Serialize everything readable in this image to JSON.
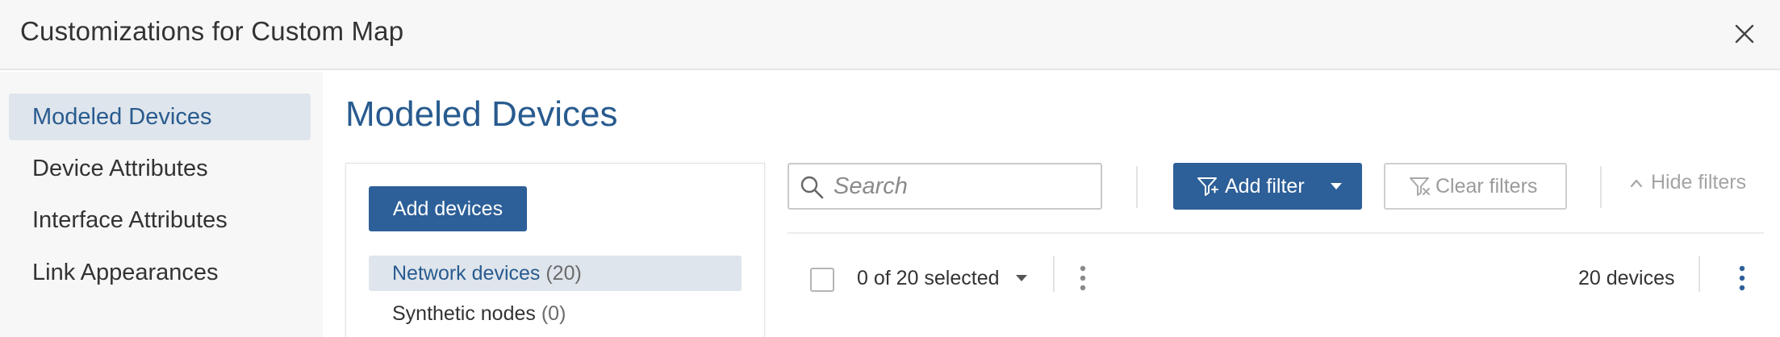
{
  "header": {
    "title": "Customizations for Custom Map"
  },
  "sidebar": {
    "items": [
      {
        "label": "Modeled Devices",
        "active": true
      },
      {
        "label": "Device Attributes",
        "active": false
      },
      {
        "label": "Interface Attributes",
        "active": false
      },
      {
        "label": "Link Appearances",
        "active": false
      }
    ]
  },
  "main": {
    "title": "Modeled Devices",
    "add_devices_label": "Add devices",
    "node_types": [
      {
        "label": "Network devices",
        "count": "(20)",
        "active": true
      },
      {
        "label": "Synthetic nodes",
        "count": "(0)",
        "active": false
      }
    ],
    "search": {
      "placeholder": "Search",
      "value": ""
    },
    "add_filter_label": "Add filter",
    "clear_filters_label": "Clear filters",
    "hide_filters_label": "Hide filters",
    "selection_text": "0 of 20 selected",
    "device_count": "20 devices"
  },
  "icons": {
    "close": "close-icon",
    "search": "search-icon",
    "filter": "filter-icon",
    "filter_clear": "filter-clear-icon",
    "caret": "caret-down-icon",
    "chevron_up": "chevron-up-icon",
    "kebab": "more-vertical-icon"
  },
  "colors": {
    "accent": "#2d5f98",
    "title_blue": "#285b8f",
    "active_bg": "#dfe5ec",
    "header_bg": "#f7f7f7"
  }
}
